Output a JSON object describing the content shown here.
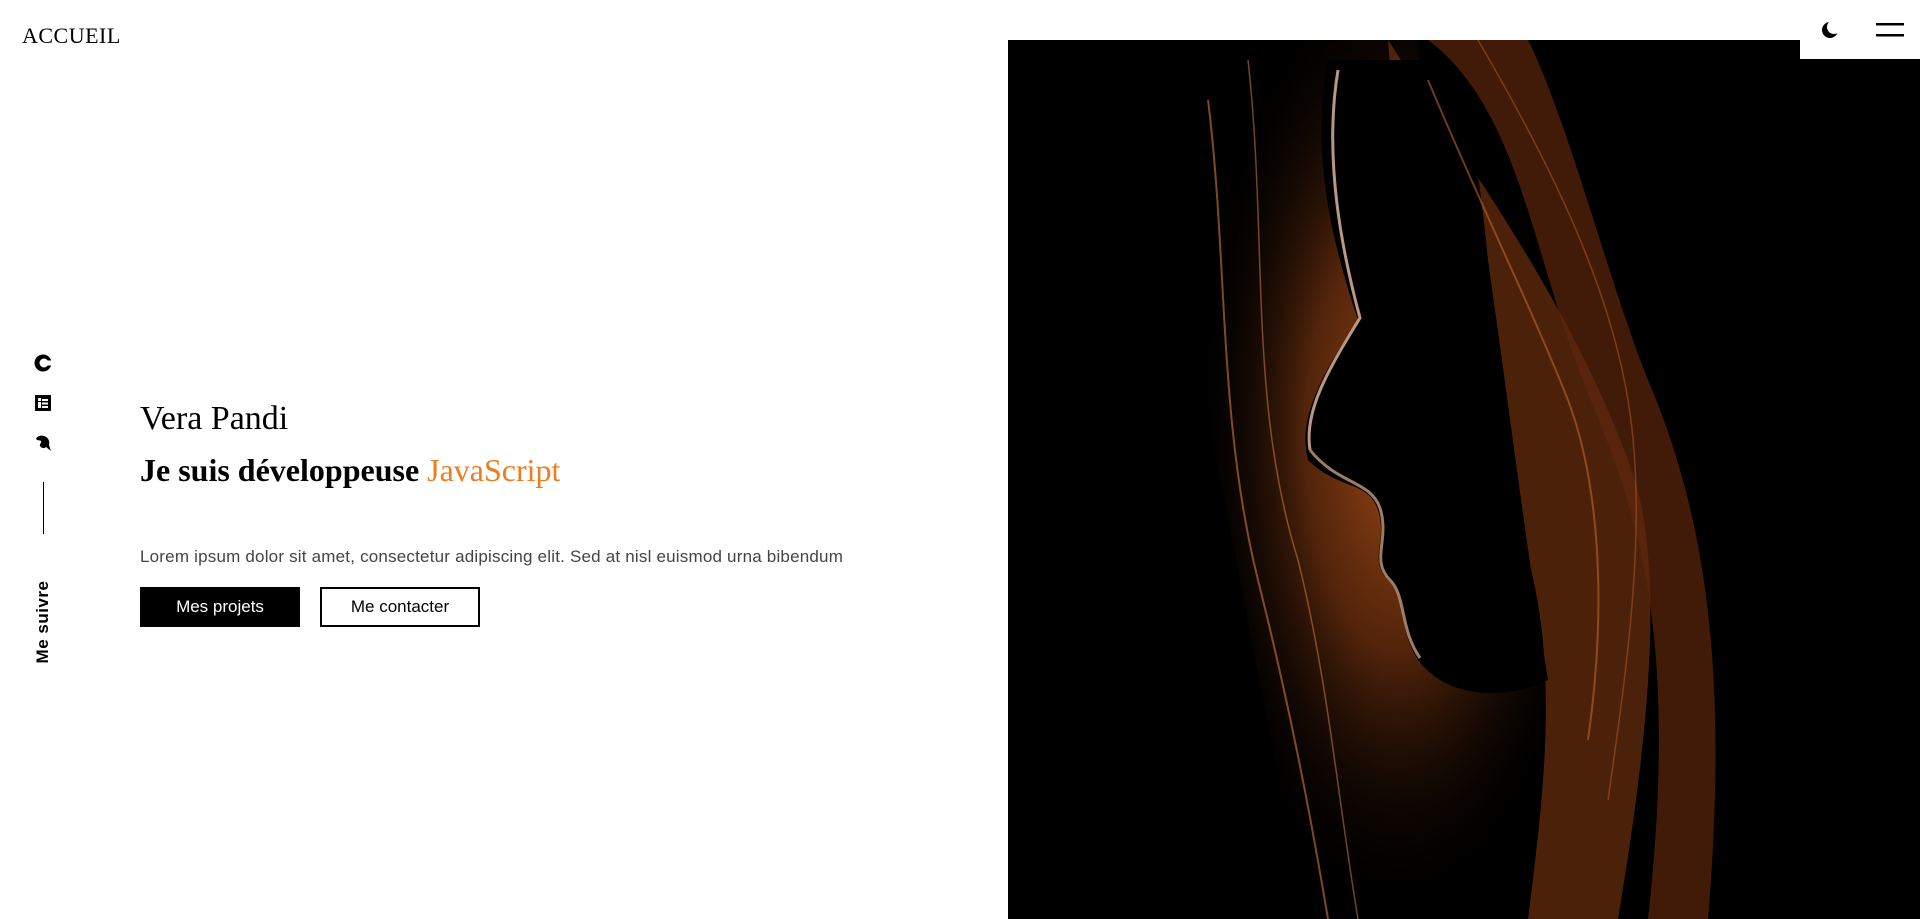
{
  "header": {
    "logo_text": "ACCUEIL"
  },
  "social": {
    "icons": [
      "codepen-icon",
      "linkedin-icon",
      "github-icon"
    ],
    "follow_label": "Me suivre"
  },
  "hero": {
    "name": "Vera Pandi",
    "tagline_prefix": "Je suis développeuse ",
    "tagline_accent": "JavaScript",
    "description": "Lorem ipsum dolor sit amet, consectetur adipiscing elit. Sed at nisl euismod urna bibendum",
    "primary_button": "Mes projets",
    "secondary_button": "Me contacter",
    "accent_color": "#f07c1e"
  },
  "controls": {
    "theme_icon": "moon-icon",
    "menu_icon": "menu-icon"
  },
  "portrait": {
    "icon": "portrait-photo"
  }
}
